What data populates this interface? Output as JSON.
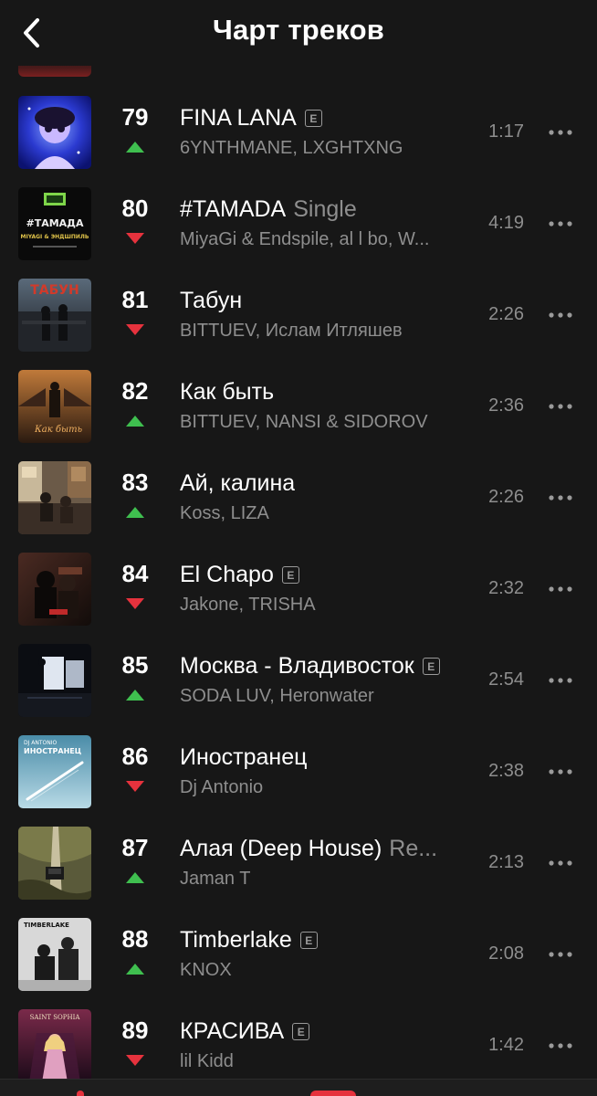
{
  "header": {
    "title": "Чарт треков",
    "back_icon": "chevron-left-icon"
  },
  "colors": {
    "background": "#171717",
    "trend_up": "#3fbf4f",
    "trend_down": "#e6323d",
    "secondary_text": "#8e8e8e"
  },
  "tracks": [
    {
      "rank": "79",
      "trend": "up",
      "title": "FINA LANA",
      "suffix": "",
      "explicit": true,
      "explicit_label": "E",
      "artist": "6YNTHMANE, LXGHTXNG",
      "duration": "1:17"
    },
    {
      "rank": "80",
      "trend": "down",
      "title": "#TAMADA",
      "suffix": "Single",
      "explicit": false,
      "explicit_label": "",
      "artist": "MiyaGi & Endspile, al l bo, W...",
      "duration": "4:19"
    },
    {
      "rank": "81",
      "trend": "down",
      "title": "Табун",
      "suffix": "",
      "explicit": false,
      "explicit_label": "",
      "artist": "BITTUEV, Ислам Итляшев",
      "duration": "2:26"
    },
    {
      "rank": "82",
      "trend": "up",
      "title": "Как быть",
      "suffix": "",
      "explicit": false,
      "explicit_label": "",
      "artist": "BITTUEV, NANSI & SIDOROV",
      "duration": "2:36"
    },
    {
      "rank": "83",
      "trend": "up",
      "title": "Ай, калина",
      "suffix": "",
      "explicit": false,
      "explicit_label": "",
      "artist": "Koss, LIZA",
      "duration": "2:26"
    },
    {
      "rank": "84",
      "trend": "down",
      "title": "El Chapo",
      "suffix": "",
      "explicit": true,
      "explicit_label": "E",
      "artist": "Jakone, TRISHA",
      "duration": "2:32"
    },
    {
      "rank": "85",
      "trend": "up",
      "title": "Москва - Владивосток",
      "suffix": "",
      "explicit": true,
      "explicit_label": "E",
      "artist": "SODA LUV, Heronwater",
      "duration": "2:54"
    },
    {
      "rank": "86",
      "trend": "down",
      "title": "Иностранец",
      "suffix": "",
      "explicit": false,
      "explicit_label": "",
      "artist": "Dj Antonio",
      "duration": "2:38"
    },
    {
      "rank": "87",
      "trend": "up",
      "title": "Алая (Deep House)",
      "suffix": "Re...",
      "explicit": false,
      "explicit_label": "",
      "artist": "Jaman T",
      "duration": "2:13"
    },
    {
      "rank": "88",
      "trend": "up",
      "title": "Timberlake",
      "suffix": "",
      "explicit": true,
      "explicit_label": "E",
      "artist": "KNOX",
      "duration": "2:08"
    },
    {
      "rank": "89",
      "trend": "down",
      "title": "КРАСИВА",
      "suffix": "",
      "explicit": true,
      "explicit_label": "E",
      "artist": "lil Kidd",
      "duration": "1:42"
    }
  ],
  "covers": {
    "tamada_text_1": "#ТАМАДА",
    "tamada_text_2": "MIYAGI & ЭНДШПИЛЬ",
    "tabun_text": "ТАБУН",
    "kak_byt_text": "Как быть",
    "inostranets_text_1": "DJ ANTONIO",
    "inostranets_text_2": "ИНОСТРАНЕЦ",
    "timberlake_text": "TIMBERLAKE",
    "krasiva_text": "SAINT SOPHIA"
  }
}
